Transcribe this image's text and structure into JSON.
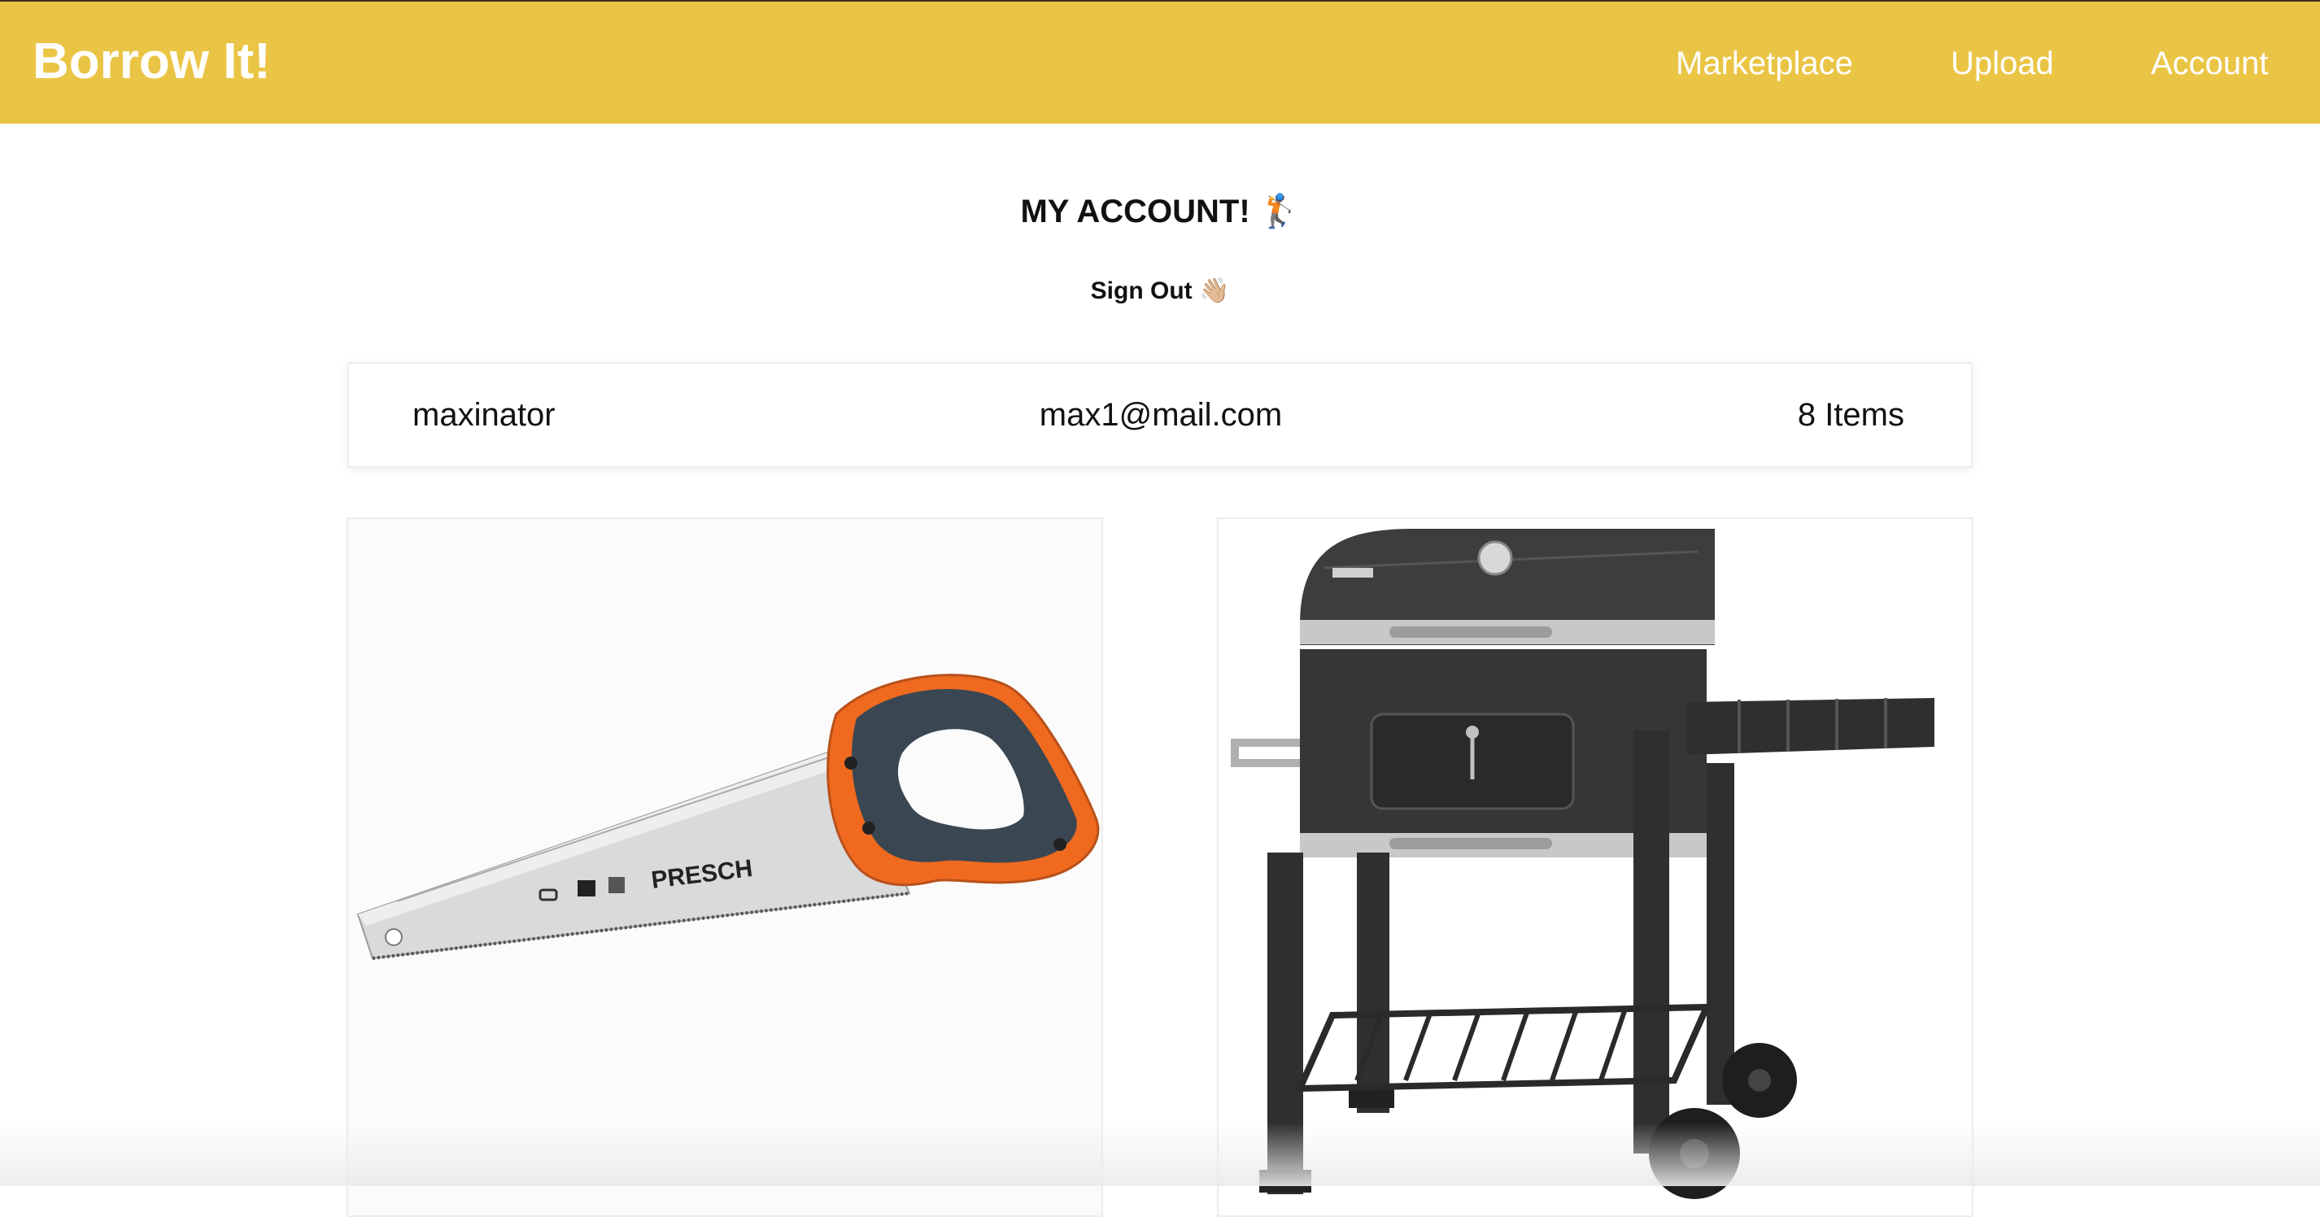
{
  "navbar": {
    "brand": "Borrow It!",
    "links": [
      "Marketplace",
      "Upload",
      "Account"
    ],
    "background_color": "#EAC545"
  },
  "account": {
    "title": "MY ACCOUNT! 🏌️",
    "sign_out": "Sign Out 👋🏼",
    "username": "maxinator",
    "email": "max1@mail.com",
    "item_count": "8 Items"
  },
  "items": [
    {
      "image": "hand-saw-image",
      "brand_text": "PRESCH"
    },
    {
      "image": "charcoal-grill-image"
    }
  ]
}
